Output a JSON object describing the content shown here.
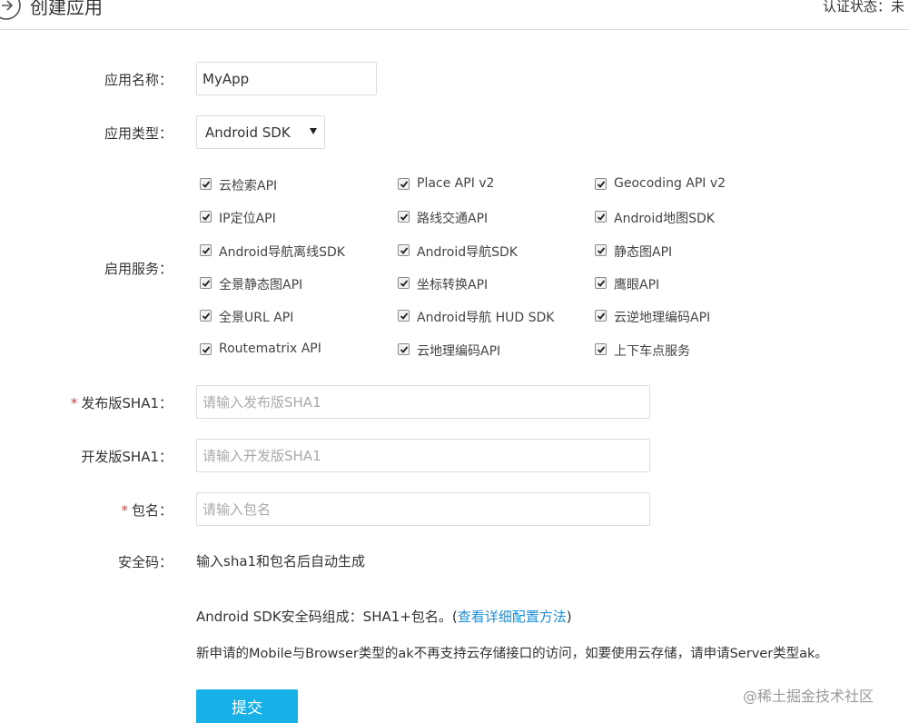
{
  "header": {
    "title": "创建应用",
    "auth_status": "认证状态：未"
  },
  "form": {
    "app_name": {
      "label": "应用名称：",
      "value": "MyApp"
    },
    "app_type": {
      "label": "应用类型：",
      "selected": "Android SDK"
    },
    "services": {
      "label": "启用服务：",
      "items": [
        {
          "label": "云检索API",
          "checked": true
        },
        {
          "label": "Place API v2",
          "checked": true
        },
        {
          "label": "Geocoding API v2",
          "checked": true
        },
        {
          "label": "IP定位API",
          "checked": true
        },
        {
          "label": "路线交通API",
          "checked": true
        },
        {
          "label": "Android地图SDK",
          "checked": true
        },
        {
          "label": "Android导航离线SDK",
          "checked": true
        },
        {
          "label": "Android导航SDK",
          "checked": true
        },
        {
          "label": "静态图API",
          "checked": true
        },
        {
          "label": "全景静态图API",
          "checked": true
        },
        {
          "label": "坐标转换API",
          "checked": true
        },
        {
          "label": "鹰眼API",
          "checked": true
        },
        {
          "label": "全景URL API",
          "checked": true
        },
        {
          "label": "Android导航 HUD SDK",
          "checked": true
        },
        {
          "label": "云逆地理编码API",
          "checked": true
        },
        {
          "label": "Routematrix API",
          "checked": true
        },
        {
          "label": "云地理编码API",
          "checked": true
        },
        {
          "label": "上下车点服务",
          "checked": true
        }
      ]
    },
    "release_sha1": {
      "required_mark": "*",
      "label": "发布版SHA1：",
      "placeholder": "请输入发布版SHA1"
    },
    "dev_sha1": {
      "label": "开发版SHA1：",
      "placeholder": "请输入开发版SHA1"
    },
    "package_name": {
      "required_mark": "*",
      "label": "包名：",
      "placeholder": "请输入包名"
    },
    "security_code": {
      "label": "安全码：",
      "value": "输入sha1和包名后自动生成"
    }
  },
  "notes": {
    "composition_prefix": "Android SDK安全码组成：SHA1+包名。(",
    "composition_link": "查看详细配置方法",
    "composition_suffix": ")",
    "storage_notice": "新申请的Mobile与Browser类型的ak不再支持云存储接口的访问，如要使用云存储，请申请Server类型ak。"
  },
  "submit_label": "提交",
  "watermark": "@稀土掘金技术社区"
}
